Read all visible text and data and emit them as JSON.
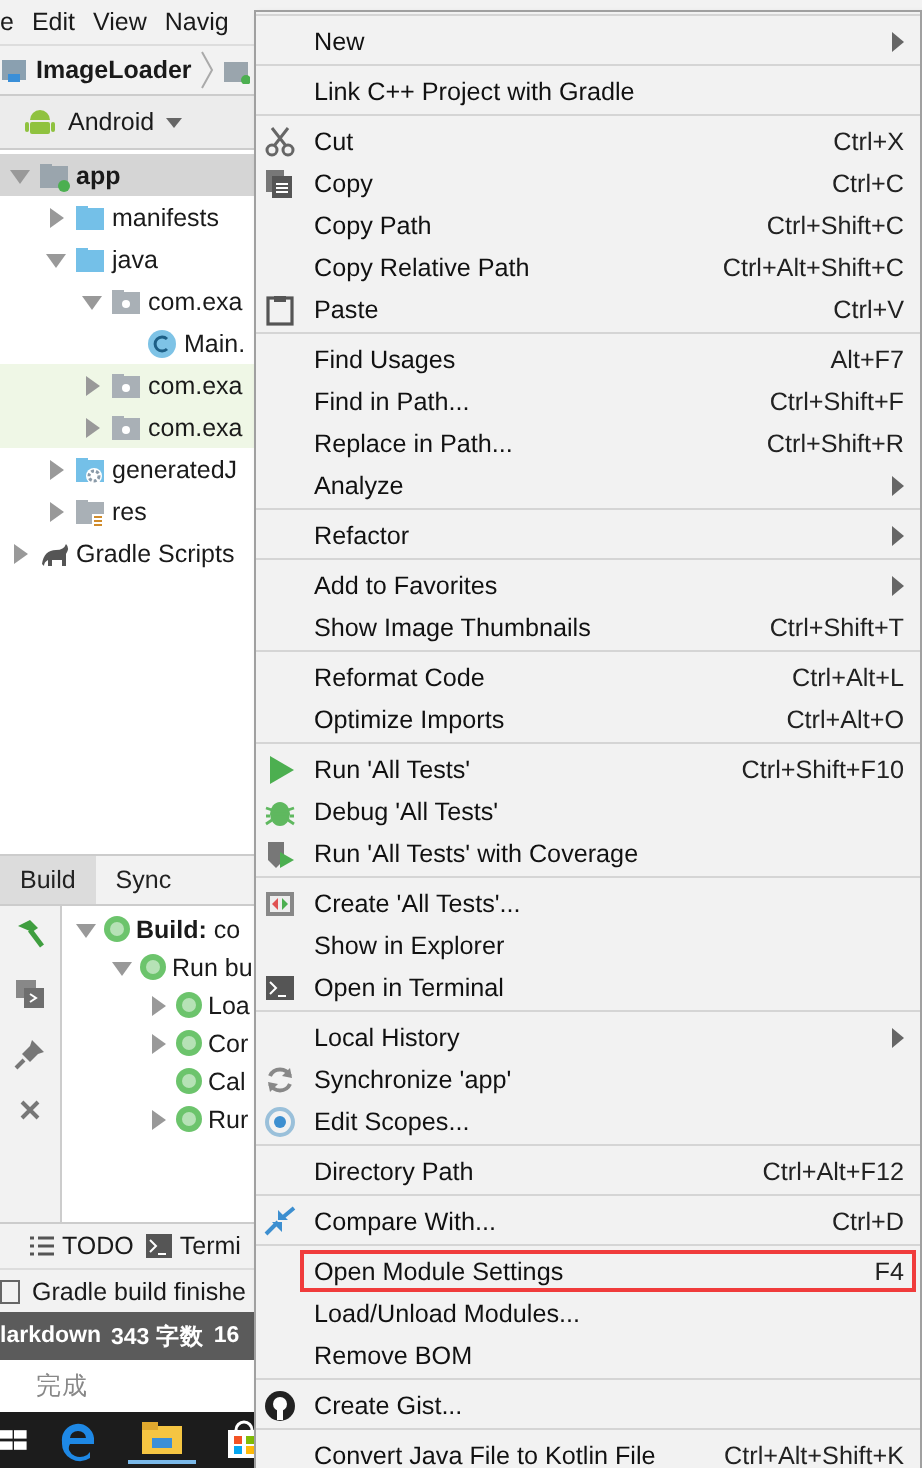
{
  "menubar": [
    "e",
    "Edit",
    "View",
    "Navig"
  ],
  "breadcrumb": {
    "project": "ImageLoader"
  },
  "project_view": {
    "mode": "Android"
  },
  "tree": [
    {
      "label": "app",
      "expanded": true,
      "selected": true,
      "highlighted": false,
      "kind": "module",
      "children": [
        {
          "label": "manifests",
          "expanded": false,
          "selected": false,
          "highlighted": false,
          "kind": "folder"
        },
        {
          "label": "java",
          "expanded": true,
          "selected": false,
          "highlighted": false,
          "kind": "folder",
          "children": [
            {
              "label": "com.exa",
              "expanded": true,
              "selected": false,
              "highlighted": false,
              "kind": "package",
              "children": [
                {
                  "label": "Main.",
                  "selected": false,
                  "highlighted": false,
                  "kind": "class"
                }
              ]
            },
            {
              "label": "com.exa",
              "expanded": false,
              "selected": false,
              "highlighted": true,
              "kind": "package"
            },
            {
              "label": "com.exa",
              "expanded": false,
              "selected": false,
              "highlighted": true,
              "kind": "package"
            }
          ]
        },
        {
          "label": "generatedJ",
          "expanded": false,
          "selected": false,
          "highlighted": false,
          "kind": "generated"
        },
        {
          "label": "res",
          "expanded": false,
          "selected": false,
          "highlighted": false,
          "kind": "res"
        }
      ]
    },
    {
      "label": "Gradle Scripts",
      "expanded": false,
      "selected": false,
      "highlighted": false,
      "kind": "gradle"
    }
  ],
  "build_tabs": [
    {
      "label": "Build",
      "selected": true
    },
    {
      "label": "Sync",
      "selected": false
    }
  ],
  "build_tree": [
    {
      "label": "**Build:** co",
      "expanded": true,
      "children": [
        {
          "label": "Run bu",
          "expanded": true,
          "children": [
            {
              "label": "Loa",
              "expanded": false
            },
            {
              "label": "Cor",
              "expanded": false
            },
            {
              "label": "Cal"
            },
            {
              "label": "Rur",
              "expanded": false
            }
          ]
        }
      ]
    }
  ],
  "bottom_tabs": [
    {
      "label": "TODO",
      "kind": "list"
    },
    {
      "label": "Termi",
      "kind": "terminal"
    }
  ],
  "status_message": "Gradle build finishe",
  "editor_bar": [
    "larkdown",
    "343 字数",
    "16"
  ],
  "editor_status": "完成",
  "context_menu": {
    "groups": [
      {
        "items": [
          {
            "label": "New",
            "submenu": true,
            "highlighted": false
          }
        ]
      },
      {
        "items": [
          {
            "label": "Link C++ Project with Gradle",
            "submenu": false,
            "highlighted": false
          }
        ]
      },
      {
        "items": [
          {
            "label": "Cut",
            "shortcut": "Ctrl+X",
            "kind": "scissors",
            "submenu": false,
            "highlighted": false
          },
          {
            "label": "Copy",
            "shortcut": "Ctrl+C",
            "kind": "copy",
            "submenu": false,
            "highlighted": false
          },
          {
            "label": "Copy Path",
            "shortcut": "Ctrl+Shift+C",
            "submenu": false,
            "highlighted": false
          },
          {
            "label": "Copy Relative Path",
            "shortcut": "Ctrl+Alt+Shift+C",
            "submenu": false,
            "highlighted": false
          },
          {
            "label": "Paste",
            "shortcut": "Ctrl+V",
            "kind": "clipboard",
            "submenu": false,
            "highlighted": false
          }
        ]
      },
      {
        "items": [
          {
            "label": "Find Usages",
            "shortcut": "Alt+F7",
            "submenu": false,
            "highlighted": false
          },
          {
            "label": "Find in Path...",
            "shortcut": "Ctrl+Shift+F",
            "submenu": false,
            "highlighted": false
          },
          {
            "label": "Replace in Path...",
            "shortcut": "Ctrl+Shift+R",
            "submenu": false,
            "highlighted": false
          },
          {
            "label": "Analyze",
            "submenu": true,
            "highlighted": false
          }
        ]
      },
      {
        "items": [
          {
            "label": "Refactor",
            "submenu": true,
            "highlighted": false
          }
        ]
      },
      {
        "items": [
          {
            "label": "Add to Favorites",
            "submenu": true,
            "highlighted": false
          },
          {
            "label": "Show Image Thumbnails",
            "shortcut": "Ctrl+Shift+T",
            "submenu": false,
            "highlighted": false
          }
        ]
      },
      {
        "items": [
          {
            "label": "Reformat Code",
            "shortcut": "Ctrl+Alt+L",
            "submenu": false,
            "highlighted": false
          },
          {
            "label": "Optimize Imports",
            "shortcut": "Ctrl+Alt+O",
            "submenu": false,
            "highlighted": false
          }
        ]
      },
      {
        "items": [
          {
            "label": "Run 'All Tests'",
            "shortcut": "Ctrl+Shift+F10",
            "kind": "play",
            "submenu": false,
            "highlighted": false
          },
          {
            "label": "Debug 'All Tests'",
            "kind": "bug",
            "submenu": false,
            "highlighted": false
          },
          {
            "label": "Run 'All Tests' with Coverage",
            "kind": "shield",
            "submenu": false,
            "highlighted": false
          }
        ]
      },
      {
        "items": [
          {
            "label": "Create 'All Tests'...",
            "kind": "test",
            "submenu": false,
            "highlighted": false
          },
          {
            "label": "Show in Explorer",
            "submenu": false,
            "highlighted": false
          },
          {
            "label": "Open in Terminal",
            "kind": "terminal",
            "submenu": false,
            "highlighted": false
          }
        ]
      },
      {
        "items": [
          {
            "label": "Local History",
            "submenu": true,
            "highlighted": false
          },
          {
            "label": "Synchronize 'app'",
            "kind": "sync",
            "submenu": false,
            "highlighted": false
          },
          {
            "label": "Edit Scopes...",
            "kind": "scope",
            "submenu": false,
            "highlighted": false
          }
        ]
      },
      {
        "items": [
          {
            "label": "Directory Path",
            "shortcut": "Ctrl+Alt+F12",
            "submenu": false,
            "highlighted": false
          }
        ]
      },
      {
        "items": [
          {
            "label": "Compare With...",
            "shortcut": "Ctrl+D",
            "kind": "compare",
            "submenu": false,
            "highlighted": false
          }
        ]
      },
      {
        "items": [
          {
            "label": "Open Module Settings",
            "shortcut": "F4",
            "submenu": false,
            "highlighted": true
          },
          {
            "label": "Load/Unload Modules...",
            "submenu": false,
            "highlighted": false
          },
          {
            "label": "Remove BOM",
            "submenu": false,
            "highlighted": false
          }
        ]
      },
      {
        "items": [
          {
            "label": "Create Gist...",
            "kind": "cat",
            "submenu": false,
            "highlighted": false
          }
        ]
      },
      {
        "items": [
          {
            "label": "Convert Java File to Kotlin File",
            "shortcut": "Ctrl+Alt+Shift+K",
            "submenu": false,
            "highlighted": false
          }
        ]
      }
    ]
  }
}
